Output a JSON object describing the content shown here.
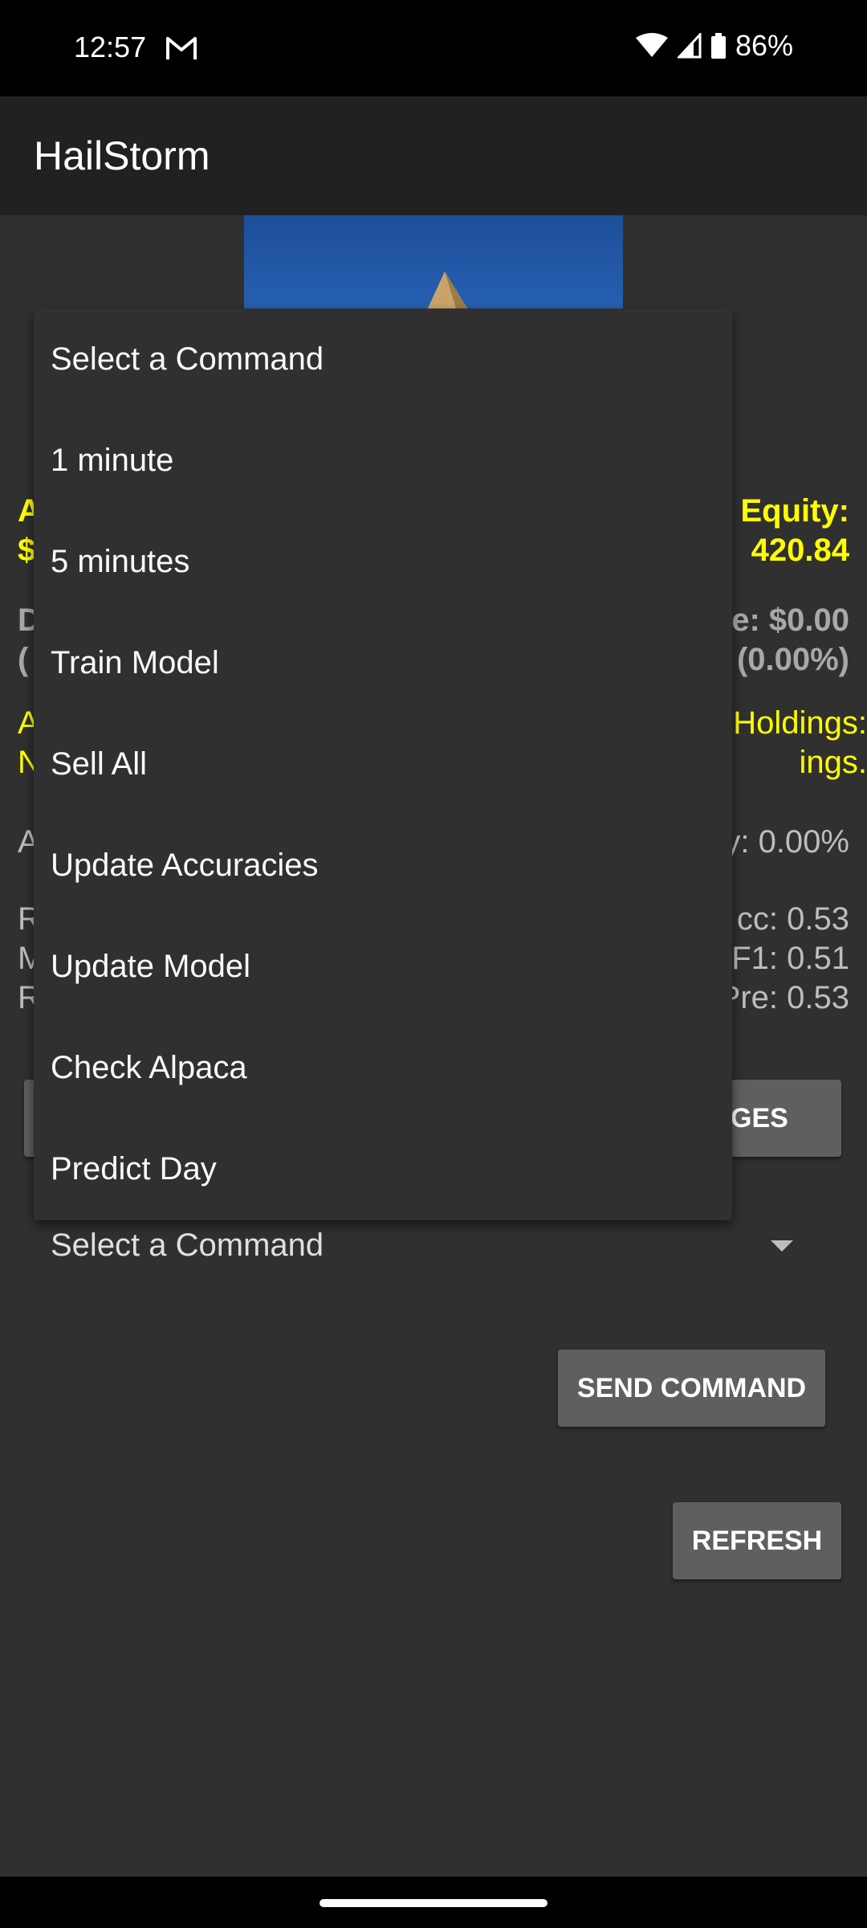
{
  "status_bar": {
    "time": "12:57",
    "battery": "86%"
  },
  "app_bar": {
    "title": "HailStorm"
  },
  "account": {
    "left_yellow_1": "A",
    "left_yellow_2": "$",
    "equity_label": "Equity:",
    "equity_value": "420.84",
    "left_gray_1": "D",
    "left_gray_2": "(",
    "daily_change": "e: $0.00",
    "daily_change_pct": "(0.00%)",
    "left_holdings_1": "A",
    "left_holdings_2": "N",
    "holdings_label": "Holdings:",
    "holdings_value": "ings.",
    "left_accuracy": "A",
    "accuracy_text": "y: 0.00%",
    "left_metric_1": "R",
    "left_metric_2": "M",
    "left_metric_3": "R",
    "metric_acc": "cc: 0.53",
    "metric_f1": "F1: 0.51",
    "metric_pre": "Pre: 0.53"
  },
  "buttons": {
    "ges_partial": "GES",
    "send_command": "SEND COMMAND",
    "refresh": "REFRESH"
  },
  "spinner": {
    "selected": "Select a Command"
  },
  "dropdown": {
    "items": [
      "Select a Command",
      "1 minute",
      "5 minutes",
      "Train Model",
      "Sell All",
      "Update Accuracies",
      "Update Model",
      "Check Alpaca",
      "Predict Day"
    ]
  },
  "colors": {
    "background": "#303030",
    "app_bar": "#212121",
    "accent_yellow": "#ffff00",
    "button_gray": "#5f5f5f"
  }
}
